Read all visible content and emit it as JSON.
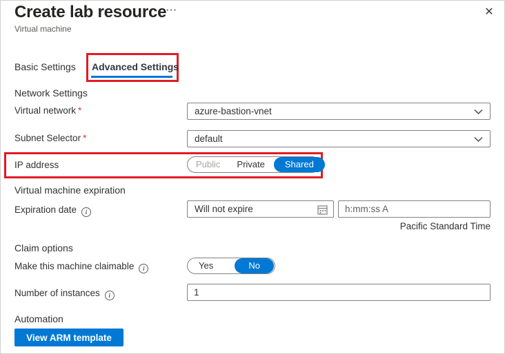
{
  "header": {
    "title": "Create lab resource",
    "subtitle": "Virtual machine"
  },
  "icons": {
    "more": "···",
    "close": "✕",
    "info": "i"
  },
  "tabs": [
    {
      "label": "Basic Settings",
      "selected": false
    },
    {
      "label": "Advanced Settings",
      "selected": true
    }
  ],
  "network_settings": {
    "heading": "Network Settings",
    "virtual_network": {
      "label": "Virtual network",
      "required": "*",
      "value": "azure-bastion-vnet"
    },
    "subnet_selector": {
      "label": "Subnet Selector",
      "required": "*",
      "value": "default"
    },
    "ip_address": {
      "label": "IP address",
      "options": [
        "Public",
        "Private",
        "Shared"
      ],
      "selected": "Shared",
      "disabled_option": "Public"
    }
  },
  "vm_expiration": {
    "heading": "Virtual machine expiration",
    "expiration_date": {
      "label": "Expiration date",
      "value": "Will not expire"
    },
    "time": {
      "placeholder": "h:mm:ss A"
    },
    "timezone": "Pacific Standard Time"
  },
  "claim_options": {
    "heading": "Claim options",
    "claimable": {
      "label": "Make this machine claimable",
      "options": [
        "Yes",
        "No"
      ],
      "selected": "No"
    },
    "instances": {
      "label": "Number of instances",
      "value": "1"
    }
  },
  "automation": {
    "heading": "Automation",
    "button_label": "View ARM template"
  },
  "colors": {
    "accent": "#0078d4",
    "annotation_red": "#e01b24",
    "required_red": "#d13438"
  }
}
